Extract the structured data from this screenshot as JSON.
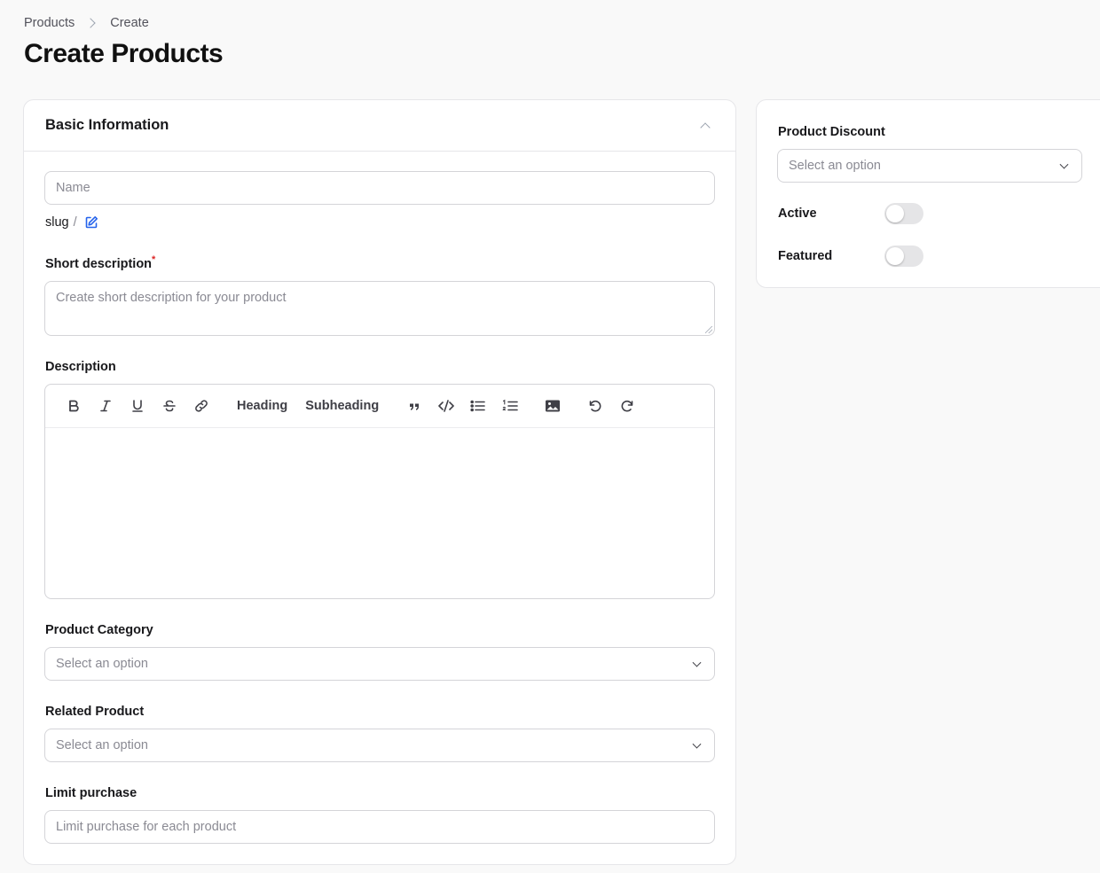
{
  "breadcrumb": {
    "parent": "Products",
    "current": "Create"
  },
  "page": {
    "title": "Create Products"
  },
  "basic_info": {
    "title": "Basic Information",
    "name_placeholder": "Name",
    "slug_label": "slug",
    "slug_sep": "/",
    "short_description": {
      "label": "Short description",
      "required_mark": "*",
      "placeholder": "Create short description for your product"
    },
    "description": {
      "label": "Description",
      "toolbar": {
        "heading": "Heading",
        "subheading": "Subheading"
      }
    },
    "category": {
      "label": "Product Category",
      "placeholder": "Select an option"
    },
    "related": {
      "label": "Related Product",
      "placeholder": "Select an option"
    },
    "limit": {
      "label": "Limit purchase",
      "placeholder": "Limit purchase for each product"
    }
  },
  "sidebar": {
    "discount": {
      "label": "Product Discount",
      "placeholder": "Select an option"
    },
    "active": {
      "label": "Active",
      "value": false
    },
    "featured": {
      "label": "Featured",
      "value": false
    }
  },
  "colors": {
    "accent": "#2563eb",
    "required": "#dc2626"
  },
  "icons": [
    "chevron-right-icon",
    "chevron-up-icon",
    "edit-icon",
    "bold-icon",
    "italic-icon",
    "underline-icon",
    "strike-icon",
    "link-icon",
    "quote-icon",
    "code-icon",
    "bullet-list-icon",
    "ordered-list-icon",
    "image-icon",
    "undo-icon",
    "redo-icon",
    "chevron-down-icon"
  ]
}
